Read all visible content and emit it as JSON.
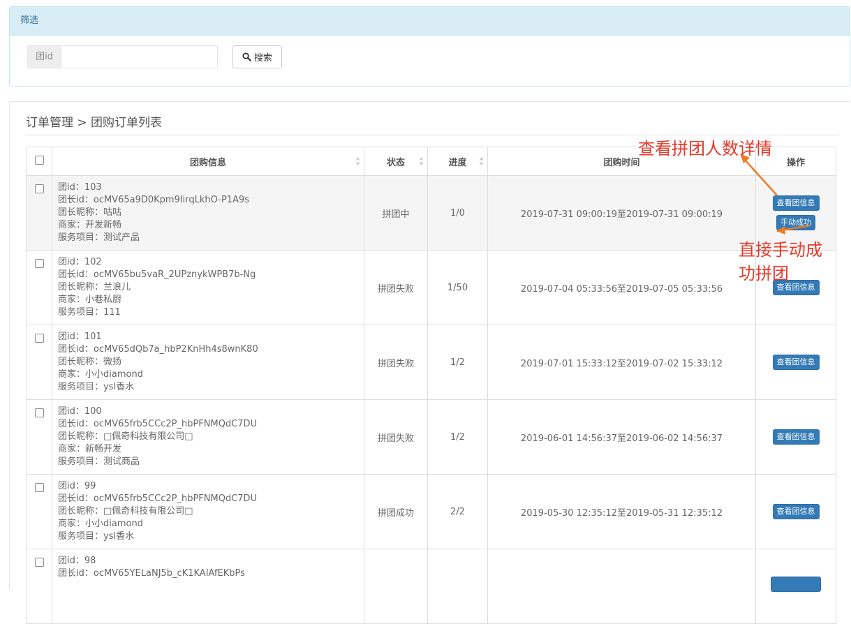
{
  "filter": {
    "title": "筛选",
    "field_label": "团id",
    "field_value": "",
    "search_label": "搜索"
  },
  "breadcrumb": "订单管理 > 团购订单列表",
  "table": {
    "headers": {
      "info": "团购信息",
      "status": "状态",
      "progress": "进度",
      "time": "团购时间",
      "action": "操作"
    },
    "rows": [
      {
        "group_id": "团id：103",
        "leader_id": "团长id：ocMV65a9D0Kpm9IirqLkhO-P1A9s",
        "leader_nick": "团长昵称：咕咕",
        "merchant": "商家：开发新畅",
        "service": "服务项目：测试产品",
        "status": "拼团中",
        "progress": "1/0",
        "time": "2019-07-31 09:00:19至2019-07-31 09:00:19",
        "view_btn": "查看团信息",
        "manual_btn": "手动成功"
      },
      {
        "group_id": "团id：102",
        "leader_id": "团长id：ocMV65bu5vaR_2UPznykWPB7b-Ng",
        "leader_nick": "团长昵称：兰浪儿",
        "merchant": "商家：小巷私厨",
        "service": "服务项目：111",
        "status": "拼团失败",
        "progress": "1/50",
        "time": "2019-07-04 05:33:56至2019-07-05 05:33:56",
        "view_btn": "查看团信息"
      },
      {
        "group_id": "团id：101",
        "leader_id": "团长id：ocMV65dQb7a_hbP2KnHh4s8wnK80",
        "leader_nick": "团长昵称：微扬",
        "merchant": "商家：小小diamond",
        "service": "服务项目：ysl香水",
        "status": "拼团失败",
        "progress": "1/2",
        "time": "2019-07-01 15:33:12至2019-07-02 15:33:12",
        "view_btn": "查看团信息"
      },
      {
        "group_id": "团id：100",
        "leader_id": "团长id：ocMV65frb5CCc2P_hbPFNMQdC7DU",
        "leader_nick": "团长昵称：□佩奇科技有限公司□",
        "merchant": "商家：新畅开发",
        "service": "服务项目：测试商品",
        "status": "拼团失败",
        "progress": "1/2",
        "time": "2019-06-01 14:56:37至2019-06-02 14:56:37",
        "view_btn": "查看团信息"
      },
      {
        "group_id": "团id：99",
        "leader_id": "团长id：ocMV65frb5CCc2P_hbPFNMQdC7DU",
        "leader_nick": "团长昵称：□佩奇科技有限公司□",
        "merchant": "商家：小小diamond",
        "service": "服务项目：ysl香水",
        "status": "拼团成功",
        "progress": "2/2",
        "time": "2019-05-30 12:35:12至2019-05-31 12:35:12",
        "view_btn": "查看团信息"
      },
      {
        "group_id": "团id：98",
        "leader_id": "团长id：ocMV65YELaNJ5b_cK1KAIAfEKbPs",
        "leader_nick": "",
        "merchant": "",
        "service": "",
        "status": "",
        "progress": "",
        "time": "",
        "view_btn": ""
      }
    ]
  },
  "annotations": {
    "view_detail": "查看拼团人数详情",
    "manual_success_line1": "直接手动成",
    "manual_success_line2": "功拼团",
    "color": "#e8392b"
  },
  "colors": {
    "panel_head_bg": "#d9edf7",
    "primary_button": "#337ab7"
  }
}
